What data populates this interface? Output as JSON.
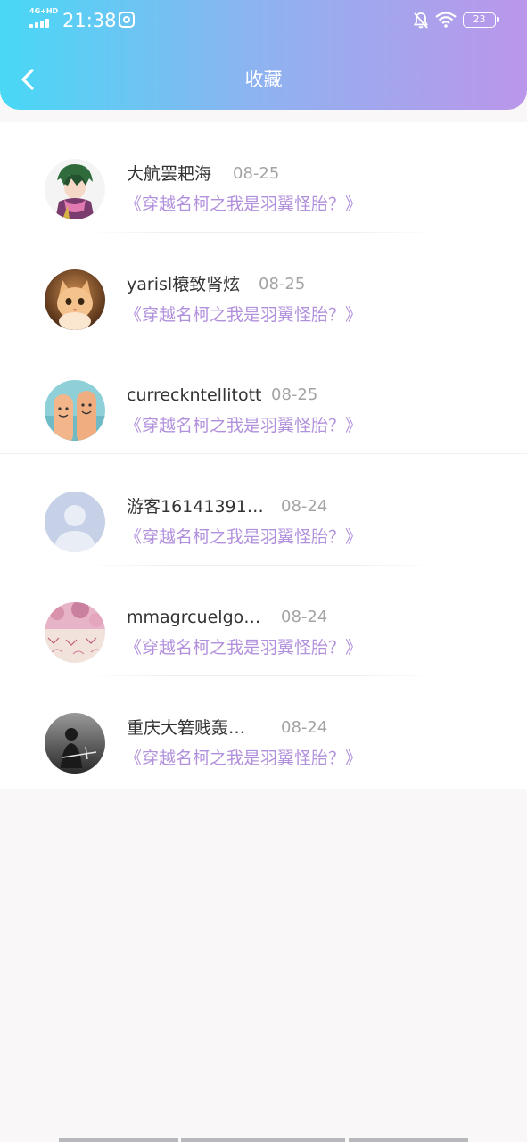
{
  "status_bar": {
    "network": "4G+HD",
    "time": "21:38",
    "battery": "23",
    "icons": [
      "signal-icon",
      "chat-app-icon",
      "mute-bell-icon",
      "wifi-icon",
      "battery-icon"
    ]
  },
  "header": {
    "title": "收藏",
    "back_icon": "chevron-left-icon"
  },
  "items": [
    {
      "username": "大航罢耙海",
      "date": "08-25",
      "book": "《穿越名柯之我是羽翼怪胎？》",
      "avatar": "anime-character-avatar"
    },
    {
      "username": "yarisl榱致肾炫",
      "date": "08-25",
      "book": "《穿越名柯之我是羽翼怪胎？》",
      "avatar": "kitten-avatar"
    },
    {
      "username": "curreckntellitott",
      "date": "08-25",
      "book": "《穿越名柯之我是羽翼怪胎？》",
      "avatar": "finger-faces-avatar"
    },
    {
      "username": "游客16141391…",
      "date": "08-24",
      "book": "《穿越名柯之我是羽翼怪胎？》",
      "avatar": "default-user-avatar"
    },
    {
      "username": "mmagrcuelgo…",
      "date": "08-24",
      "book": "《穿越名柯之我是羽翼怪胎？》",
      "avatar": "pink-pattern-avatar"
    },
    {
      "username": "重庆大箬贱轰…",
      "date": "08-24",
      "book": "《穿越名柯之我是羽翼怪胎？》",
      "avatar": "dark-portrait-avatar"
    }
  ],
  "colors": {
    "header_gradient_start": "#48d8f6",
    "header_gradient_end": "#bb96ea",
    "book_title": "#b291dc",
    "date": "#a3a3a3",
    "username": "#333333"
  }
}
